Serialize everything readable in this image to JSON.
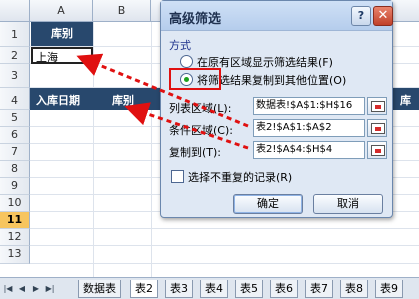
{
  "sheet": {
    "columns": [
      "A",
      "B"
    ],
    "rows": [
      "1",
      "2",
      "3",
      "4",
      "5",
      "6",
      "7",
      "8",
      "9",
      "10",
      "11",
      "12",
      "13"
    ],
    "selected_row": "11",
    "cells": {
      "A1": "库别",
      "A2": "上海",
      "D4": "入库日期",
      "E4": "库别",
      "F4": "库"
    }
  },
  "tabs": {
    "items": [
      "数据表",
      "表2",
      "表3",
      "表4",
      "表5",
      "表6",
      "表7",
      "表8",
      "表9"
    ],
    "active": "表2"
  },
  "dialog": {
    "title": "高级筛选",
    "help_label": "?",
    "close_label": "✕",
    "method_label": "方式",
    "radio_inplace": "在原有区域显示筛选结果(F)",
    "radio_copy": "将筛选结果复制到其他位置(O)",
    "list_range_label": "列表区域(L):",
    "list_range_value": "数据表!$A$1:$H$16",
    "criteria_range_label": "条件区域(C):",
    "criteria_range_value": "表2!$A$1:$A$2",
    "copy_to_label": "复制到(T):",
    "copy_to_value": "表2!$A$4:$H$4",
    "unique_label": "选择不重复的记录(R)",
    "ok_label": "确定",
    "cancel_label": "取消"
  },
  "colors": {
    "header_dark": "#28486d",
    "selected_row": "#f7c55e",
    "annotation_red": "#e01010"
  }
}
